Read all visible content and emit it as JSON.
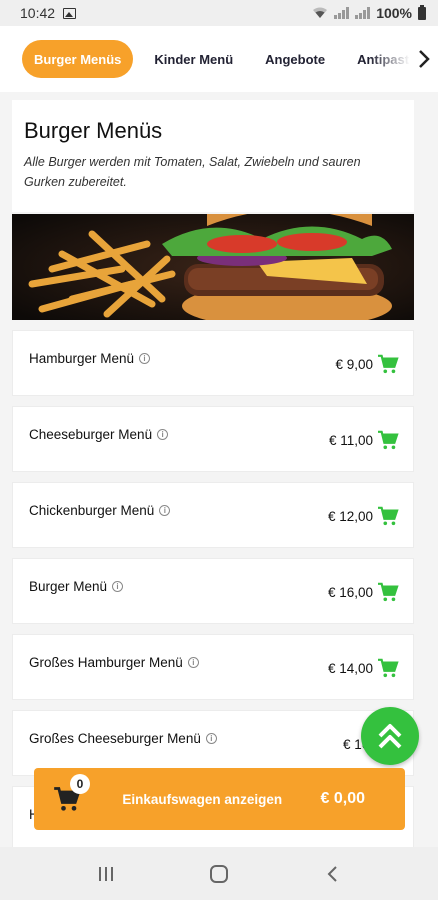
{
  "status": {
    "time": "10:42",
    "battery": "100%"
  },
  "tabs": [
    {
      "label": "Burger Menüs",
      "active": true
    },
    {
      "label": "Kinder Menü",
      "active": false
    },
    {
      "label": "Angebote",
      "active": false
    },
    {
      "label": "Antipasti",
      "active": false
    }
  ],
  "category": {
    "title": "Burger Menüs",
    "description": "Alle Burger werden mit Tomaten, Salat, Zwiebeln und sauren Gurken zubereitet."
  },
  "items": [
    {
      "name": "Hamburger Menü",
      "price": "€ 9,00"
    },
    {
      "name": "Cheeseburger Menü",
      "price": "€ 11,00"
    },
    {
      "name": "Chickenburger Menü",
      "price": "€ 12,00"
    },
    {
      "name": "Burger Menü",
      "price": "€ 16,00"
    },
    {
      "name": "Großes Hamburger Menü",
      "price": "€ 14,00"
    },
    {
      "name": "Großes Cheeseburger Menü",
      "price": "€ 16,"
    },
    {
      "name": "H",
      "price": ""
    }
  ],
  "cart": {
    "count": "0",
    "label": "Einkaufswagen anzeigen",
    "total": "€ 0,00"
  },
  "icons": {
    "cart": "cart-icon",
    "scroll_top": "double-chevron-up-icon",
    "tab_next": "chevron-right-icon"
  },
  "colors": {
    "accent": "#f7a12a",
    "cart_green": "#34c13e"
  }
}
